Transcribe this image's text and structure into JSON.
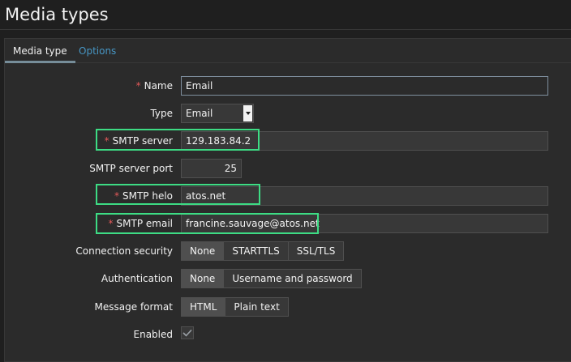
{
  "page": {
    "title": "Media types"
  },
  "tabs": [
    {
      "label": "Media type",
      "active": true
    },
    {
      "label": "Options",
      "active": false
    }
  ],
  "form": {
    "required_mark": "*",
    "name": {
      "label": "Name",
      "value": "Email"
    },
    "type": {
      "label": "Type",
      "value": "Email"
    },
    "smtp_server": {
      "label": "SMTP server",
      "value": "129.183.84.2"
    },
    "smtp_port": {
      "label": "SMTP server port",
      "value": "25"
    },
    "smtp_helo": {
      "label": "SMTP helo",
      "value": "atos.net"
    },
    "smtp_email": {
      "label": "SMTP email",
      "value": "francine.sauvage@atos.net"
    },
    "connection_security": {
      "label": "Connection security",
      "options": [
        "None",
        "STARTTLS",
        "SSL/TLS"
      ],
      "selected": "None"
    },
    "authentication": {
      "label": "Authentication",
      "options": [
        "None",
        "Username and password"
      ],
      "selected": "None"
    },
    "message_format": {
      "label": "Message format",
      "options": [
        "HTML",
        "Plain text"
      ],
      "selected": "HTML"
    },
    "enabled": {
      "label": "Enabled",
      "checked": true
    }
  },
  "colors": {
    "background": "#1f1f1f",
    "panel": "#2b2b2b",
    "accent_link": "#4796c4",
    "required": "#e45959",
    "highlight": "#3ddc84"
  }
}
